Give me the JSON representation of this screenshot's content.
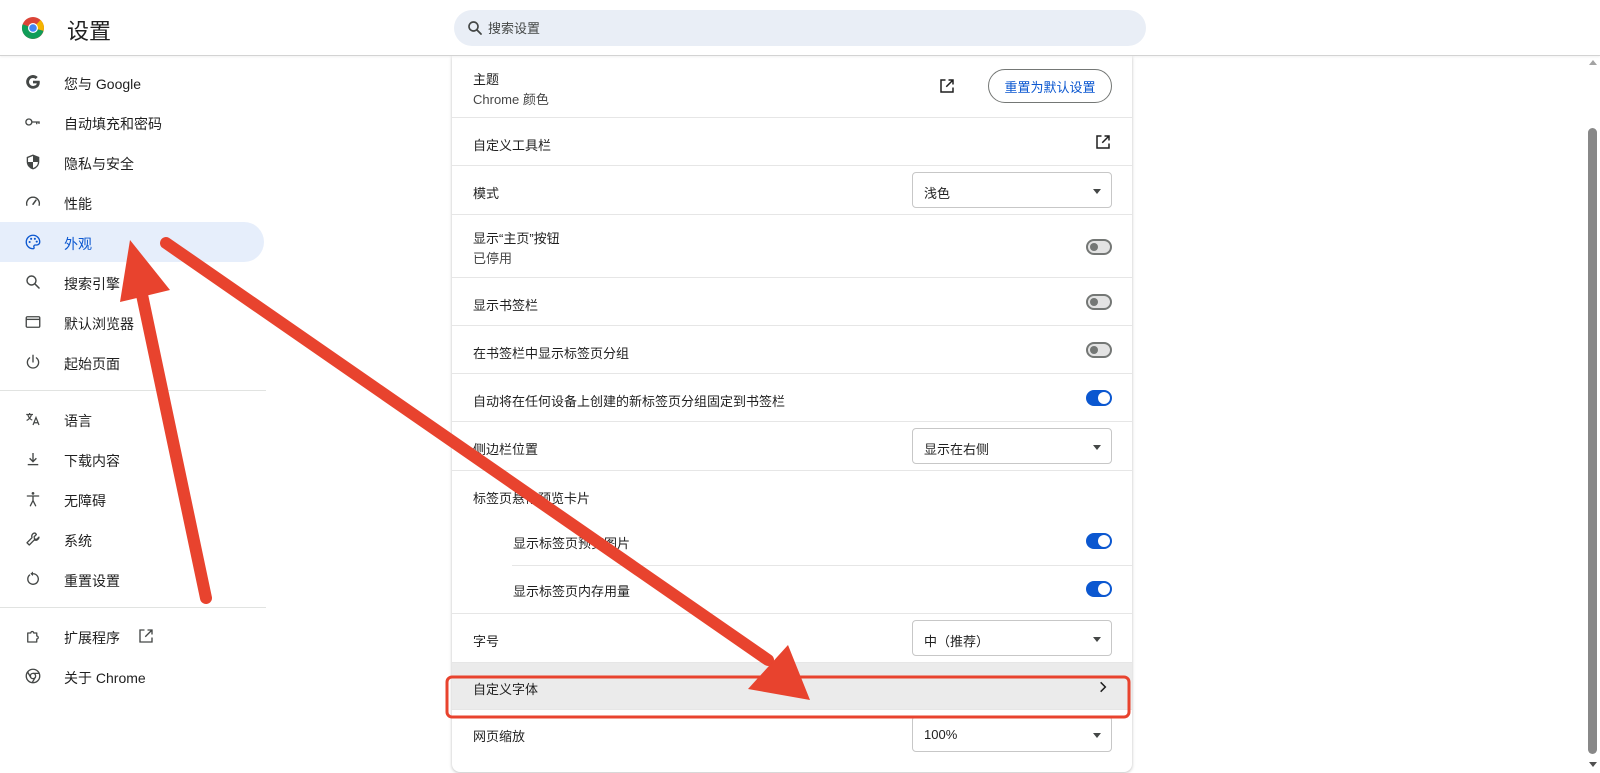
{
  "header": {
    "title": "设置",
    "search_placeholder": "搜索设置",
    "search_value": ""
  },
  "sidebar": {
    "items": [
      {
        "label": "您与 Google",
        "icon": "google-g-icon"
      },
      {
        "label": "自动填充和密码",
        "icon": "key-icon"
      },
      {
        "label": "隐私与安全",
        "icon": "shield-icon"
      },
      {
        "label": "性能",
        "icon": "speedometer-icon"
      },
      {
        "label": "外观",
        "icon": "palette-icon",
        "active": true
      },
      {
        "label": "搜索引擎",
        "icon": "search-icon"
      },
      {
        "label": "默认浏览器",
        "icon": "browser-window-icon"
      },
      {
        "label": "起始页面",
        "icon": "power-icon"
      },
      {
        "label": "语言",
        "icon": "translate-icon"
      },
      {
        "label": "下载内容",
        "icon": "download-icon"
      },
      {
        "label": "无障碍",
        "icon": "accessibility-icon"
      },
      {
        "label": "系统",
        "icon": "wrench-icon"
      },
      {
        "label": "重置设置",
        "icon": "reset-icon"
      },
      {
        "label": "扩展程序",
        "icon": "puzzle-icon"
      },
      {
        "label": "关于 Chrome",
        "icon": "chrome-icon"
      }
    ]
  },
  "appearance": {
    "theme_label": "主题",
    "theme_value": "Chrome 颜色",
    "reset_button": "重置为默认设置",
    "customize_toolbar": "自定义工具栏",
    "mode_label": "模式",
    "mode_value": "浅色",
    "home_button_label": "显示“主页”按钮",
    "home_button_status": "已停用",
    "home_button_on": false,
    "bookmarks_bar_label": "显示书签栏",
    "bookmarks_bar_on": false,
    "tab_groups_bar_label": "在书签栏中显示标签页分组",
    "tab_groups_bar_on": false,
    "pin_groups_label": "自动将在任何设备上创建的新标签页分组固定到书签栏",
    "pin_groups_on": true,
    "side_panel_label": "侧边栏位置",
    "side_panel_value": "显示在右侧",
    "hover_card_label": "标签页悬停预览卡片",
    "hover_image_label": "显示标签页预览图片",
    "hover_image_on": true,
    "hover_memory_label": "显示标签页内存用量",
    "hover_memory_on": true,
    "font_size_label": "字号",
    "font_size_value": "中（推荐）",
    "custom_fonts_label": "自定义字体",
    "page_zoom_label": "网页缩放",
    "page_zoom_value": "100%"
  },
  "colors": {
    "accent": "#0b57d0",
    "active_nav_bg": "#e6eefb",
    "annotation_red": "#e8432e"
  }
}
